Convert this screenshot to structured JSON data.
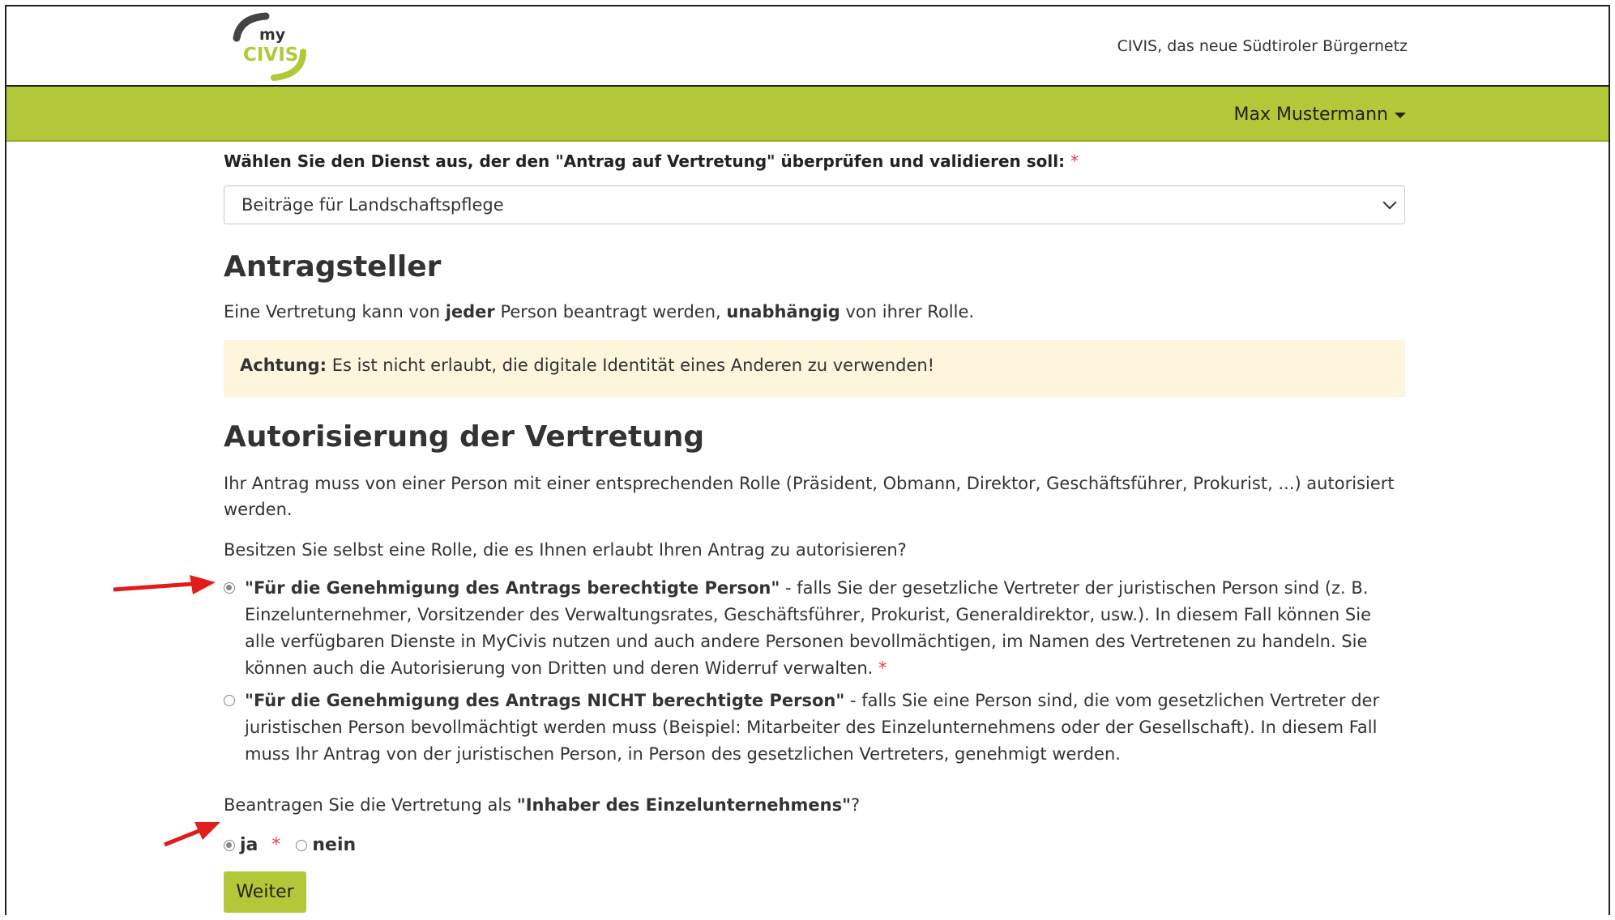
{
  "header": {
    "logo_top": "my",
    "logo_bottom": "CIVIS",
    "tagline": "CIVIS, das neue Südtiroler Bürgernetz",
    "user_name": "Max Mustermann"
  },
  "colors": {
    "brand_green": "#b3c838",
    "alert_bg": "#fdf5dc",
    "required": "#e0404a",
    "arrow": "#e21b1b"
  },
  "form": {
    "service_label": "Wählen Sie den Dienst aus, der den \"Antrag auf Vertretung\" überprüfen und validieren soll:",
    "required_mark": "*",
    "service_selected": "Beiträge für Landschaftspflege"
  },
  "applicant": {
    "title": "Antragsteller",
    "text_1": "Eine Vertretung kann von ",
    "text_bold_1": "jeder",
    "text_2": " Person beantragt werden, ",
    "text_bold_2": "unabhängig",
    "text_3": " von ihrer Rolle.",
    "alert_bold": "Achtung:",
    "alert_text": " Es ist nicht erlaubt, die digitale Identität eines Anderen zu verwenden!"
  },
  "authorization": {
    "title": "Autorisierung der Vertretung",
    "intro": "Ihr Antrag muss von einer Person mit einer entsprechenden Rolle (Präsident, Obmann, Direktor, Geschäftsführer, Prokurist, ...) autorisiert werden.",
    "question": "Besitzen Sie selbst eine Rolle, die es Ihnen erlaubt Ihren Antrag zu autorisieren?",
    "option_1_bold": "\"Für die Genehmigung des Antrags berechtigte Person\"",
    "option_1_text": " - falls Sie der gesetzliche Vertreter der juristischen Person sind (z. B. Einzelunternehmer, Vorsitzender des Verwaltungsrates, Geschäftsführer, Prokurist, Generaldirektor, usw.). In diesem Fall können Sie alle verfügbaren Dienste in MyCivis nutzen und auch andere Personen bevollmächtigen, im Namen des Vertretenen zu handeln. Sie können auch die Autorisierung von Dritten und deren Widerruf verwalten.",
    "option_2_bold": "\"Für die Genehmigung des Antrags NICHT berechtigte Person\"",
    "option_2_text": " - falls Sie eine Person sind, die vom gesetzlichen Vertreter der juristischen Person bevollmächtigt werden muss (Beispiel: Mitarbeiter des Einzelunternehmens oder der Gesellschaft). In diesem Fall muss Ihr Antrag von der juristischen Person, in Person des gesetzlichen Vertreters, genehmigt werden.",
    "owner_question_1": "Beantragen Sie die Vertretung als ",
    "owner_question_bold": "\"Inhaber des Einzelunternehmens\"",
    "owner_question_2": "?",
    "yes_label": "ja",
    "no_label": "nein",
    "submit_label": "Weiter"
  }
}
